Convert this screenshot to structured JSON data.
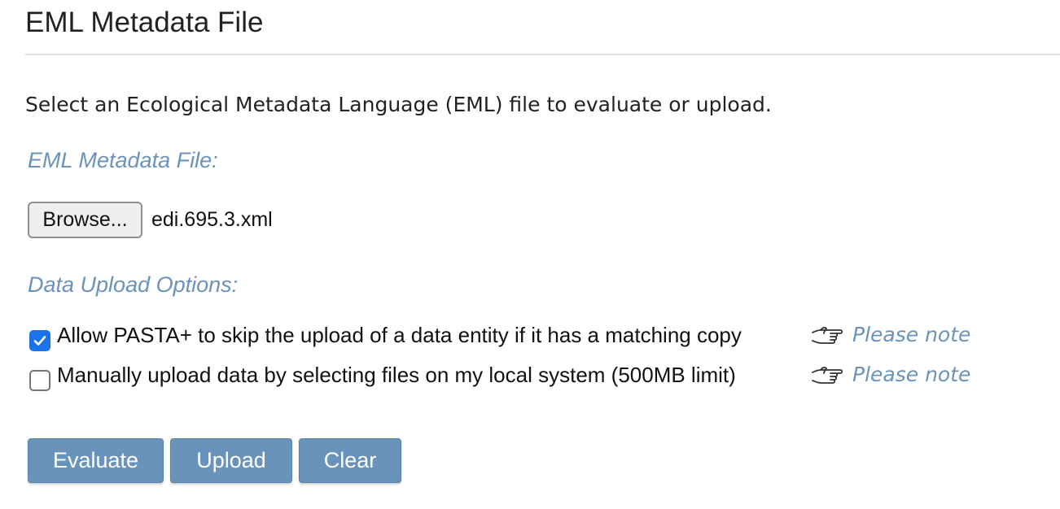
{
  "page": {
    "title": "EML Metadata File",
    "intro": "Select an Ecological Metadata Language (EML) file to evaluate or upload."
  },
  "file_section": {
    "heading": "EML Metadata File:",
    "browse_label": "Browse...",
    "selected_file": "edi.695.3.xml"
  },
  "options_section": {
    "heading": "Data Upload Options:",
    "options": [
      {
        "label": "Allow PASTA+ to skip the upload of a data entity if it has a matching copy",
        "checked": true,
        "note_icon": "pointing-hand-icon",
        "note_label": "Please note"
      },
      {
        "label": "Manually upload data by selecting files on my local system (500MB limit)",
        "checked": false,
        "note_icon": "pointing-hand-icon",
        "note_label": "Please note"
      }
    ]
  },
  "actions": {
    "evaluate_label": "Evaluate",
    "upload_label": "Upload",
    "clear_label": "Clear"
  },
  "colors": {
    "accent": "#6a93bc",
    "checkbox_checked": "#1a73e8",
    "text": "#222222",
    "rule": "#e2e2e2"
  }
}
